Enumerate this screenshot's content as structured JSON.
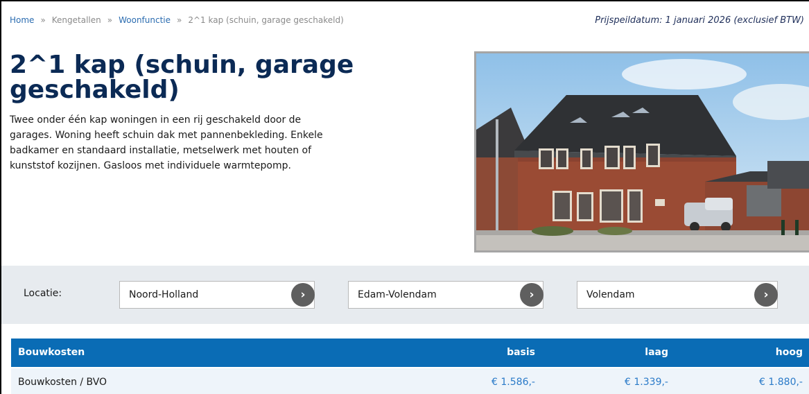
{
  "breadcrumb": {
    "items": [
      {
        "label": "Home",
        "type": "link"
      },
      {
        "label": "Kengetallen",
        "type": "muted"
      },
      {
        "label": "Woonfunctie",
        "type": "link"
      },
      {
        "label": "2^1 kap (schuin, garage geschakeld)",
        "type": "current"
      }
    ],
    "separator": "»"
  },
  "price_date": "Prijspeildatum: 1 januari 2026 (exclusief BTW)",
  "title": "2^1 kap (schuin, garage geschakeld)",
  "description": "Twee onder één kap woningen in een rij geschakeld door de garages. Woning heeft schuin dak met pannenbekleding. Enkele badkamer en standaard installatie, metselwerk met houten of kunststof kozijnen. Gasloos met individuele warmtepomp.",
  "location": {
    "label": "Locatie:",
    "province": "Noord-Holland",
    "municipality": "Edam-Volendam",
    "place": "Volendam",
    "button_glyph": "›"
  },
  "table": {
    "headers": {
      "name": "Bouwkosten",
      "basis": "basis",
      "laag": "laag",
      "hoog": "hoog"
    },
    "rows": [
      {
        "name": "Bouwkosten / BVO",
        "basis": "€ 1.586,-",
        "laag": "€ 1.339,-",
        "hoog": "€ 1.880,-"
      }
    ]
  },
  "colors": {
    "title": "#0b2a55",
    "link": "#2b6cb0",
    "header_bg": "#0a6cb5",
    "row_bg": "#eef4fa",
    "band_bg": "#e7ebef",
    "value": "#2a7ac8"
  },
  "icons": {
    "location_button": "chevron-right-icon"
  }
}
